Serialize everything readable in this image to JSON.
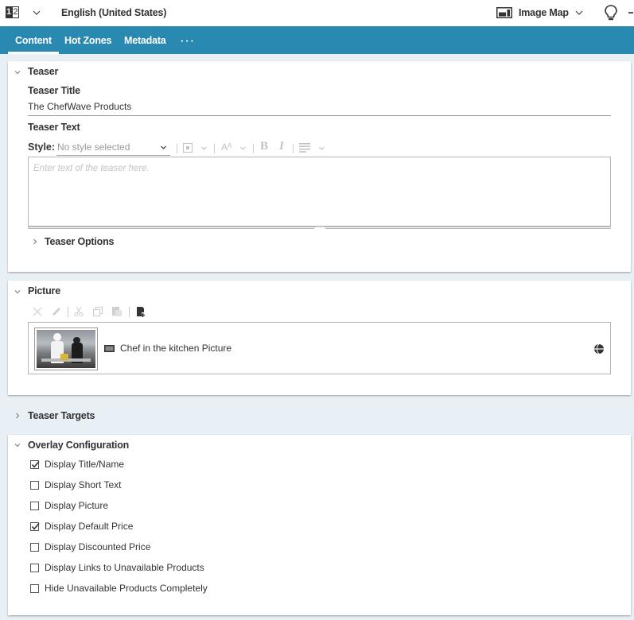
{
  "topbar": {
    "language_icon": "language-locale-icon",
    "language_digits": [
      "1",
      "2"
    ],
    "language": "English (United States)",
    "doc_type": "Image Map",
    "doc_type_icon": "image-map-icon",
    "tips_icon": "lightbulb-icon"
  },
  "tabs": [
    {
      "label": "Content",
      "active": true
    },
    {
      "label": "Hot Zones",
      "active": false
    },
    {
      "label": "Metadata",
      "active": false
    }
  ],
  "tabs_more": "···",
  "teaser": {
    "header": "Teaser",
    "title_label": "Teaser Title",
    "title_value": "The ChefWave Products",
    "text_label": "Teaser Text",
    "style_label": "Style:",
    "style_value": "No style selected",
    "text_placeholder": "Enter text of the teaser here.",
    "options_label": "Teaser Options",
    "toolbar_icons": [
      "block-format-icon",
      "font-size-icon",
      "bold-icon",
      "italic-icon",
      "align-icon"
    ],
    "bold_glyph": "B",
    "italic_glyph": "I",
    "fontsize_glyph": "Aᴬ"
  },
  "picture": {
    "header": "Picture",
    "toolbar_icons": [
      "remove-icon",
      "edit-icon",
      "cut-icon",
      "copy-icon",
      "paste-icon",
      "add-from-library-icon"
    ],
    "item_name": "Chef in the kitchen Picture",
    "item_type_icon": "picture-type-icon",
    "item_status_icon": "globe-icon"
  },
  "teaser_targets": {
    "header": "Teaser Targets"
  },
  "overlay": {
    "header": "Overlay Configuration",
    "options": [
      {
        "label": "Display Title/Name",
        "checked": true
      },
      {
        "label": "Display Short Text",
        "checked": false
      },
      {
        "label": "Display Picture",
        "checked": false
      },
      {
        "label": "Display Default Price",
        "checked": true
      },
      {
        "label": "Display Discounted Price",
        "checked": false
      },
      {
        "label": "Display Links to Unavailable Products",
        "checked": false
      },
      {
        "label": "Hide Unavailable Products Completely",
        "checked": false
      }
    ]
  },
  "colors": {
    "accent": "#2a89b0",
    "background": "#e8f0f6",
    "panel": "#ffffff"
  }
}
